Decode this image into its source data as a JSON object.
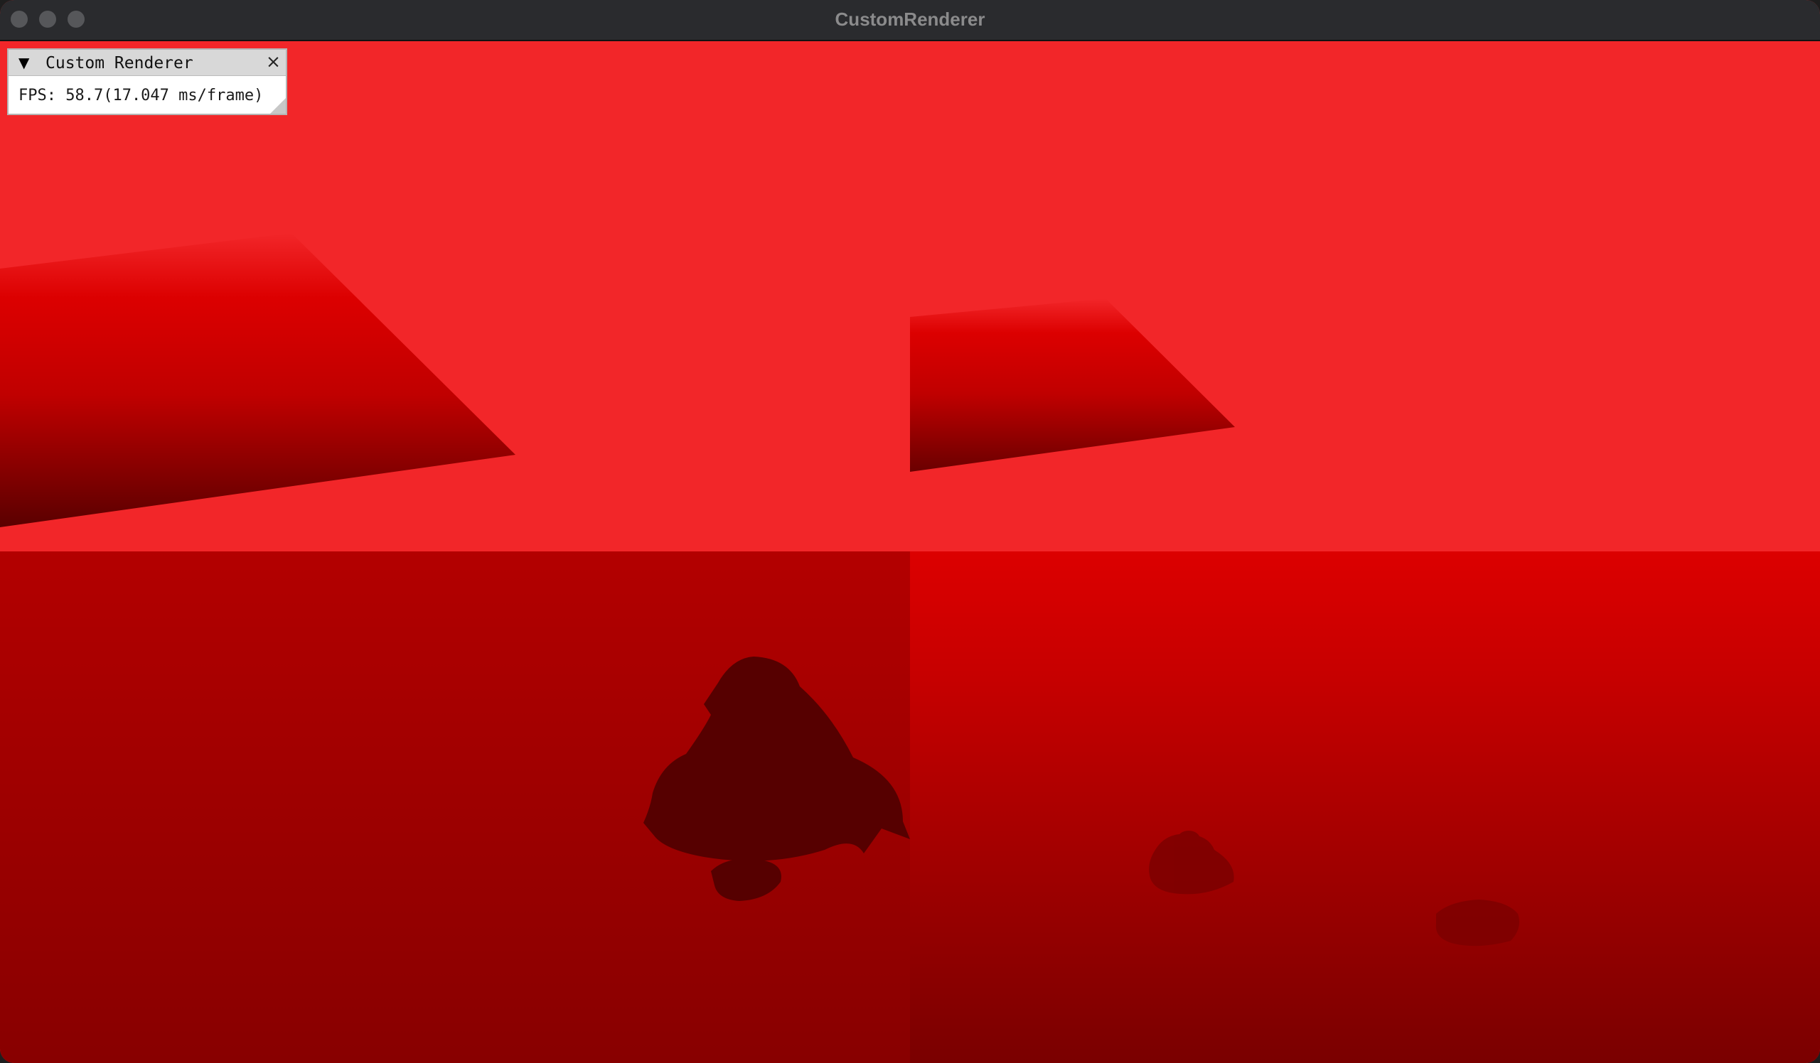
{
  "window": {
    "title": "CustomRenderer"
  },
  "panel": {
    "title": "Custom Renderer",
    "collapse_glyph": "▼",
    "close_glyph": "×",
    "fps_text": "FPS: 58.7(17.047 ms/frame)"
  },
  "colors": {
    "clear_red": "#f22629",
    "shadow_dark": "#560000"
  }
}
